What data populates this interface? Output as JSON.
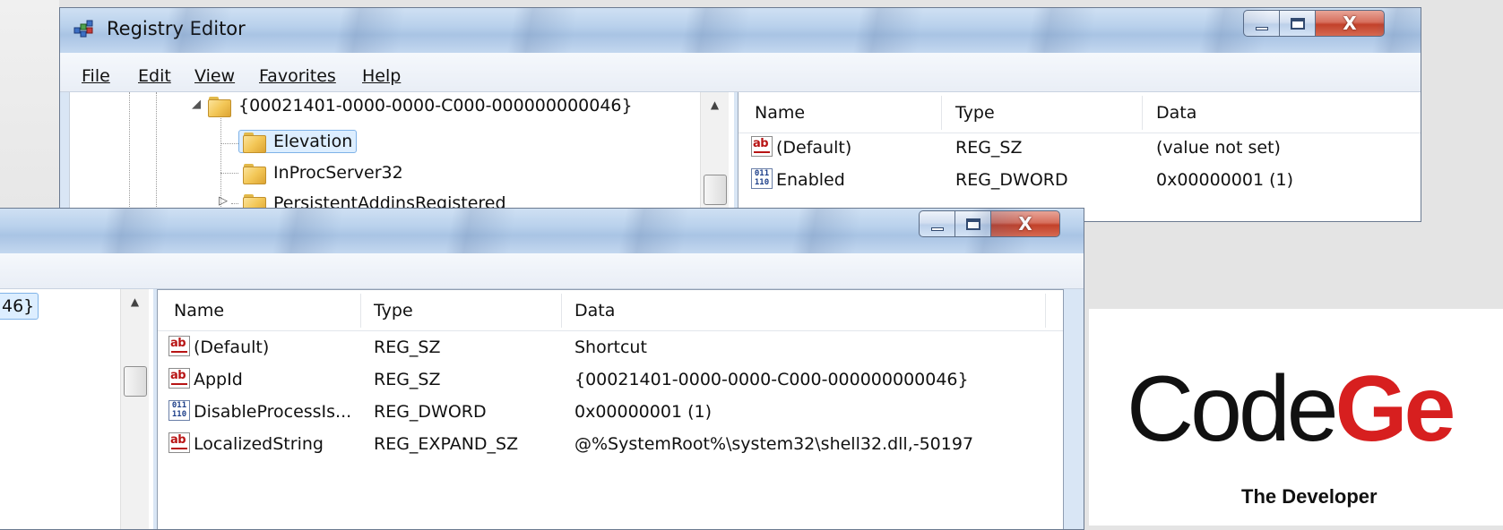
{
  "back_window": {
    "title": "Registry Editor",
    "menu": [
      "File",
      "Edit",
      "View",
      "Favorites",
      "Help"
    ],
    "tree": [
      {
        "label": "{00021401-0000-0000-C000-000000000046}",
        "expander": "◢"
      },
      {
        "label": "Elevation",
        "selected": true
      },
      {
        "label": "InProcServer32"
      },
      {
        "label": "PersistentAddinsRegistered",
        "expander": "▷"
      }
    ],
    "columns": {
      "name": "Name",
      "type": "Type",
      "data": "Data"
    },
    "values": [
      {
        "name": "(Default)",
        "type": "REG_SZ",
        "data": "(value not set)",
        "icon": "string-value-icon"
      },
      {
        "name": "Enabled",
        "type": "REG_DWORD",
        "data": "0x00000001 (1)",
        "icon": "binary-value-icon"
      }
    ]
  },
  "front_window": {
    "tree_fragment": "46}",
    "columns": {
      "name": "Name",
      "type": "Type",
      "data": "Data"
    },
    "values": [
      {
        "name": "(Default)",
        "type": "REG_SZ",
        "data": "Shortcut",
        "icon": "string-value-icon"
      },
      {
        "name": "AppId",
        "type": "REG_SZ",
        "data": "{00021401-0000-0000-C000-000000000046}",
        "icon": "string-value-icon"
      },
      {
        "name": "DisableProcessIs...",
        "type": "REG_DWORD",
        "data": "0x00000001 (1)",
        "icon": "binary-value-icon"
      },
      {
        "name": "LocalizedString",
        "type": "REG_EXPAND_SZ",
        "data": "@%SystemRoot%\\system32\\shell32.dll,-50197",
        "icon": "string-value-icon"
      }
    ]
  },
  "caption_buttons": {
    "close": "X"
  },
  "icons": {
    "string_glyph": "ab",
    "binary_glyph": "011\n110"
  },
  "logo": {
    "main": "Code",
    "accent": "Ge",
    "tagline": "The Developer"
  },
  "colors": {
    "accent": "#d71f1f",
    "close_button": "#c2412a",
    "selection": "#ddeeff"
  }
}
